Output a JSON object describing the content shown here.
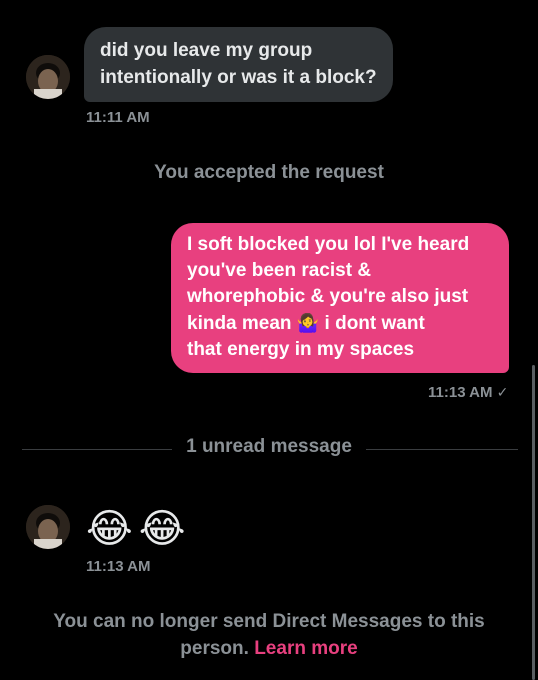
{
  "messages": {
    "incoming_1": {
      "text_line1": "did you leave my group",
      "text_line2": "intentionally or was it a block?",
      "time": "11:11 AM"
    },
    "system_accepted": "You accepted the request",
    "outgoing_1": {
      "line1": "I soft blocked you lol I've heard",
      "line2": "you've been racist &",
      "line3": "whorephobic & you're also just",
      "line4a": "kinda mean",
      "emoji": "🤷‍♀️",
      "line4b": "i dont want",
      "line5": "that energy in my spaces",
      "time": "11:13 AM",
      "status_mark": "✓"
    },
    "unread_divider": "1 unread message",
    "incoming_2": {
      "emojis": "😂😂",
      "time": "11:13 AM"
    }
  },
  "footer": {
    "notice": "You can no longer send Direct Messages to this",
    "notice_line2": "person.",
    "learn_more": "Learn more"
  },
  "colors": {
    "background": "#000000",
    "incoming_bubble": "#2f3336",
    "outgoing_bubble": "#e8407f",
    "muted_text": "#8b9196",
    "link": "#e8407f"
  },
  "icons": {
    "avatar": "avatar-photo",
    "read_receipt": "checkmark-icon"
  }
}
